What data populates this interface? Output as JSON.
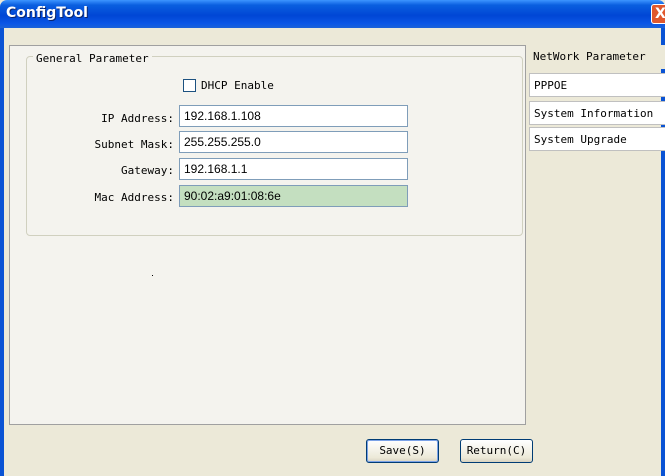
{
  "window": {
    "title": "ConfigTool",
    "close_glyph": "X"
  },
  "general": {
    "group_title": "General Parameter",
    "dhcp_label": "DHCP Enable",
    "dhcp_checked": false,
    "fields": [
      {
        "label": "IP Address:",
        "value": "192.168.1.108"
      },
      {
        "label": "Subnet Mask:",
        "value": "255.255.255.0"
      },
      {
        "label": "Gateway:",
        "value": "192.168.1.1"
      },
      {
        "label": "Mac Address:",
        "value": "90:02:a9:01:08:6e"
      }
    ]
  },
  "tabs": [
    {
      "label": "NetWork Parameter",
      "active": true
    },
    {
      "label": "PPPOE",
      "active": false
    },
    {
      "label": "System Information",
      "active": false
    },
    {
      "label": "System Upgrade",
      "active": false
    }
  ],
  "buttons": {
    "save": "Save(S)",
    "return": "Return(C)"
  },
  "colors": {
    "titlebar": "#0046d5",
    "mac_field_bg": "#c4dfc0",
    "window_bg": "#ece9d8"
  }
}
